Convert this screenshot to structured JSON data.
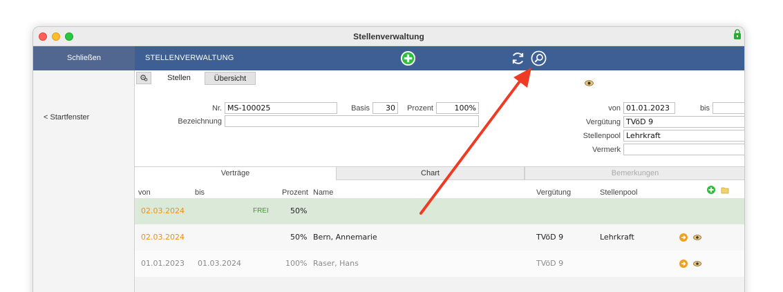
{
  "window": {
    "title": "Stellenverwaltung"
  },
  "toolbar": {
    "close_label": "Schließen",
    "module_title": "STELLENVERWALTUNG"
  },
  "sidebar": {
    "back_label": "< Startfenster"
  },
  "tabs": {
    "stellen": "Stellen",
    "uebersicht": "Übersicht"
  },
  "form": {
    "nr_label": "Nr.",
    "nr_value": "MS-100025",
    "basis_label": "Basis",
    "basis_value": "30",
    "prozent_label": "Prozent",
    "prozent_value": "100%",
    "bezeichnung_label": "Bezeichnung",
    "bezeichnung_value": "",
    "von_label": "von",
    "von_value": "01.01.2023",
    "bis_label": "bis",
    "bis_value": "",
    "verguetung_label": "Vergütung",
    "verguetung_value": "TVöD 9",
    "stellenpool_label": "Stellenpool",
    "stellenpool_value": "Lehrkraft",
    "vermerk_label": "Vermerk",
    "vermerk_value": ""
  },
  "subtabs": {
    "vertraege": "Verträge",
    "chart": "Chart",
    "bemerkungen": "Bemerkungen"
  },
  "table": {
    "headers": {
      "von": "von",
      "bis": "bis",
      "prozent": "Prozent",
      "name": "Name",
      "verguetung": "Vergütung",
      "stellenpool": "Stellenpool"
    },
    "rows": [
      {
        "von": "02.03.2024",
        "bis": "",
        "status": "FREI",
        "prozent": "50%",
        "name": "",
        "verguetung": "",
        "stellenpool": ""
      },
      {
        "von": "02.03.2024",
        "bis": "",
        "status": "",
        "prozent": "50%",
        "name": "Bern, Annemarie",
        "verguetung": "TVöD 9",
        "stellenpool": "Lehrkraft"
      },
      {
        "von": "01.01.2023",
        "bis": "01.03.2024",
        "status": "",
        "prozent": "100%",
        "name": "Raser, Hans",
        "verguetung": "TVöD 9",
        "stellenpool": ""
      }
    ]
  },
  "colors": {
    "toolbar_bg": "#3d5f93",
    "close_bg": "#51678f",
    "accent_orange": "#e89314",
    "row_free_bg": "#dbe9d8",
    "annotation_arrow": "#ee3b24"
  },
  "icons": [
    "lock-icon",
    "add-icon",
    "refresh-icon",
    "search-icon",
    "gear-icon",
    "eye-icon",
    "add-contract-icon",
    "folder-icon",
    "go-arrow-icon"
  ]
}
